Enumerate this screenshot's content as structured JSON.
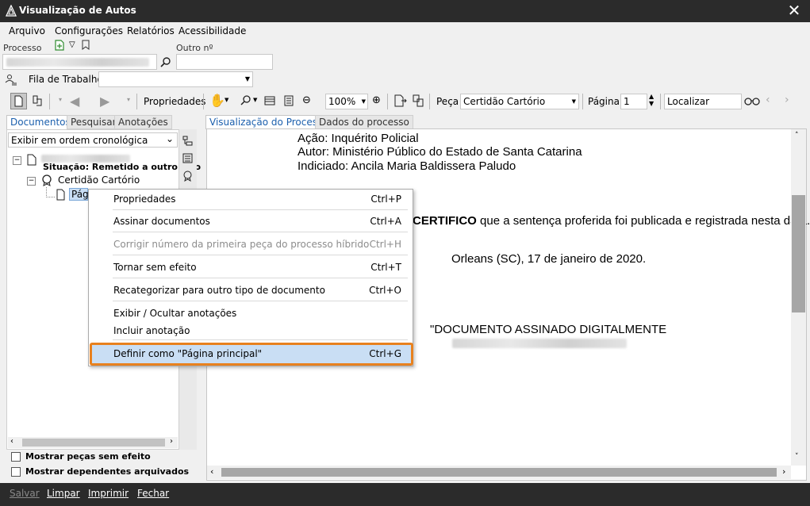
{
  "window": {
    "title": "Visualização de Autos"
  },
  "menu": [
    "Arquivo",
    "Configurações",
    "Relatórios",
    "Acessibilidade"
  ],
  "fields": {
    "processo_label": "Processo",
    "outro_label": "Outro nº",
    "fila_label": "Fila de Trabalho"
  },
  "toolbar": {
    "propriedades": "Propriedades",
    "zoom": "100%",
    "peca_label": "Peça",
    "peca_value": "Certidão Cartório",
    "pagina_label": "Página",
    "pagina_value": "1",
    "localizar_placeholder": "Localizar"
  },
  "left_tabs": [
    "Documentos",
    "Pesquisar",
    "Anotações"
  ],
  "order_select": "Exibir em ordem cronológica",
  "tree": {
    "situacao": "Situação: Remetido a outro foro",
    "certidao": "Certidão Cartório",
    "pagina": "Pág"
  },
  "checkboxes": [
    "Mostrar peças sem efeito",
    "Mostrar dependentes arquivados"
  ],
  "view_tabs": [
    "Visualização do Processo",
    "Dados do processo"
  ],
  "document": {
    "acao": "Ação: Inquérito Policial",
    "autor": "Autor: Ministério Público do Estado de Santa Catarina",
    "indiciado": "Indiciado: Ancila Maria Baldissera Paludo",
    "certifico_bold": "CERTIFICO",
    "certifico_rest": " que a sentença proferida foi publicada e registrada nesta data.",
    "local_data": "Orleans (SC), 17 de janeiro de 2020.",
    "assinado": "\"DOCUMENTO ASSINADO DIGITALMENTE"
  },
  "context_menu": [
    {
      "label": "Propriedades",
      "shortcut": "Ctrl+P"
    },
    {
      "label": "Assinar documentos",
      "shortcut": "Ctrl+A"
    },
    {
      "label": "Corrigir número da primeira peça do processo híbrido",
      "shortcut": "Ctrl+H"
    },
    {
      "label": "Tornar sem efeito",
      "shortcut": "Ctrl+T"
    },
    {
      "label": "Recategorizar para outro tipo de documento",
      "shortcut": "Ctrl+O"
    },
    {
      "label": "Exibir / Ocultar anotações",
      "shortcut": ""
    },
    {
      "label": "Incluir anotação",
      "shortcut": ""
    },
    {
      "label": "Definir como \"Página principal\"",
      "shortcut": "Ctrl+G"
    }
  ],
  "bottom": [
    "Salvar",
    "Limpar",
    "Imprimir",
    "Fechar"
  ],
  "colors": {
    "titlebar": "#2b2b2b",
    "highlight_border": "#e8811e",
    "selection": "#c9def4",
    "accent_blue": "#1b5fad"
  }
}
